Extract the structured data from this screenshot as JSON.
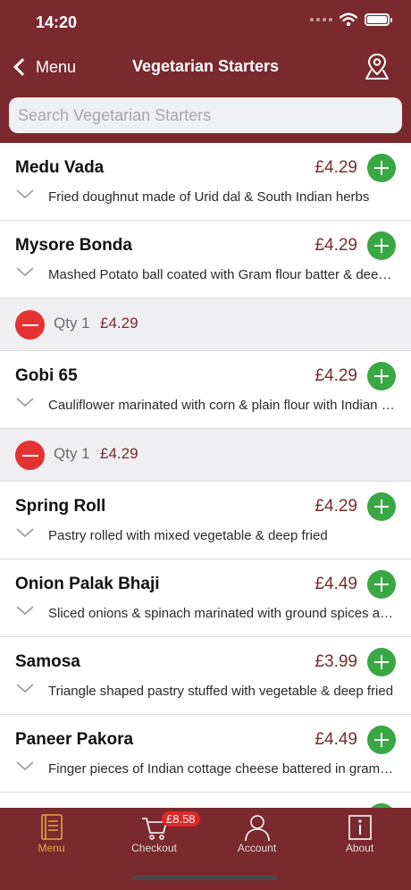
{
  "status": {
    "time": "14:20"
  },
  "nav": {
    "back_label": "Menu",
    "title": "Vegetarian Starters"
  },
  "search": {
    "placeholder": "Search Vegetarian Starters"
  },
  "items": [
    {
      "name": "Medu Vada",
      "price": "£4.29",
      "desc": "Fried doughnut made of Urid dal & South Indian herbs"
    },
    {
      "name": "Mysore Bonda",
      "price": "£4.29",
      "desc": "Mashed Potato ball coated with Gram flour batter & deep fried"
    },
    {
      "name": "Gobi 65",
      "price": "£4.29",
      "desc": "Cauliflower marinated with corn & plain flour with Indian spices"
    },
    {
      "name": "Spring Roll",
      "price": "£4.29",
      "desc": "Pastry rolled with mixed vegetable & deep fried"
    },
    {
      "name": "Onion Palak Bhaji",
      "price": "£4.49",
      "desc": "Sliced onions & spinach marinated with ground spices and fried"
    },
    {
      "name": "Samosa",
      "price": "£3.99",
      "desc": "Triangle shaped pastry stuffed with vegetable & deep fried"
    },
    {
      "name": "Paneer Pakora",
      "price": "£4.49",
      "desc": "Finger pieces of Indian cottage cheese battered in gram flour"
    }
  ],
  "qty_rows": [
    {
      "qty": "Qty 1",
      "price": "£4.29"
    },
    {
      "qty": "Qty 1",
      "price": "£4.29"
    }
  ],
  "tabs": {
    "menu": "Menu",
    "checkout": "Checkout",
    "checkout_badge": "£8.58",
    "account": "Account",
    "about": "About"
  },
  "colors": {
    "brand": "#7a2a2e",
    "add": "#3aa745",
    "remove": "#e33232",
    "active_tab": "#e8a33a"
  }
}
